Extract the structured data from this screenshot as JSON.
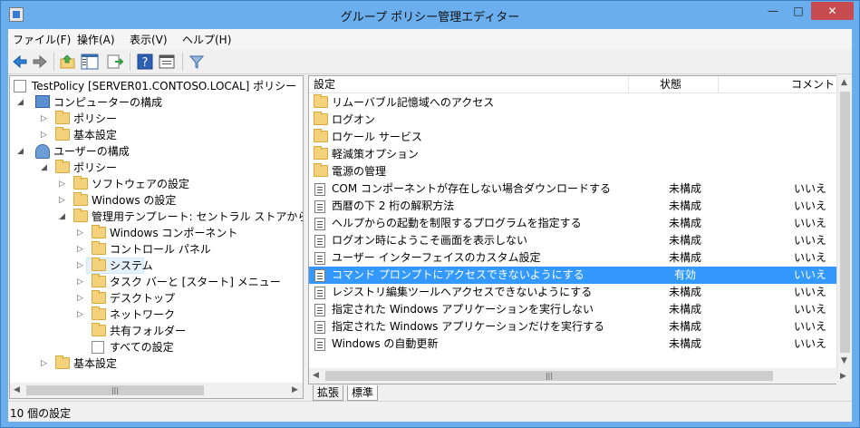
{
  "window": {
    "title": "グループ ポリシー管理エディター",
    "min_label": "—",
    "max_label": "□",
    "close_label": "✕"
  },
  "menu": {
    "file": "ファイル(F)",
    "action": "操作(A)",
    "view": "表示(V)",
    "help": "ヘルプ(H)"
  },
  "tree": {
    "root": "TestPolicy [SERVER01.CONTOSO.LOCAL] ポリシー",
    "computer_config": "コンピューターの構成",
    "computer_policy": "ポリシー",
    "computer_prefs": "基本設定",
    "user_config": "ユーザーの構成",
    "user_policy": "ポリシー",
    "software_settings": "ソフトウェアの設定",
    "windows_settings": "Windows の設定",
    "admin_templates": "管理用テンプレート: セントラル ストアから取得したポ",
    "windows_components": "Windows コンポーネント",
    "control_panel": "コントロール パネル",
    "system": "システム",
    "taskbar_start": "タスク バーと [スタート] メニュー",
    "desktop": "デスクトップ",
    "network": "ネットワーク",
    "shared_folders": "共有フォルダー",
    "all_settings": "すべての設定",
    "user_prefs": "基本設定"
  },
  "list": {
    "headers": {
      "setting": "設定",
      "state": "状態",
      "comment": "コメント"
    },
    "folders": [
      "リムーバブル記憶域へのアクセス",
      "ログオン",
      "ロケール サービス",
      "軽減策オプション",
      "電源の管理"
    ],
    "settings": [
      {
        "name": "COM コンポーネントが存在しない場合ダウンロードする",
        "state": "未構成",
        "comment": "いいえ"
      },
      {
        "name": "西暦の下 2 桁の解釈方法",
        "state": "未構成",
        "comment": "いいえ"
      },
      {
        "name": "ヘルプからの起動を制限するプログラムを指定する",
        "state": "未構成",
        "comment": "いいえ"
      },
      {
        "name": "ログオン時にようこそ画面を表示しない",
        "state": "未構成",
        "comment": "いいえ"
      },
      {
        "name": "ユーザー インターフェイスのカスタム設定",
        "state": "未構成",
        "comment": "いいえ"
      },
      {
        "name": "コマンド プロンプトにアクセスできないようにする",
        "state": "有効",
        "comment": "いいえ"
      },
      {
        "name": "レジストリ編集ツールへアクセスできないようにする",
        "state": "未構成",
        "comment": "いいえ"
      },
      {
        "name": "指定された Windows アプリケーションを実行しない",
        "state": "未構成",
        "comment": "いいえ"
      },
      {
        "name": "指定された Windows アプリケーションだけを実行する",
        "state": "未構成",
        "comment": "いいえ"
      },
      {
        "name": "Windows の自動更新",
        "state": "未構成",
        "comment": "いいえ"
      }
    ]
  },
  "tabs": {
    "extended": "拡張",
    "standard": "標準"
  },
  "scroll": {
    "grip": "|||"
  },
  "status": {
    "text": "10 個の設定"
  },
  "colors": {
    "title_bar": "#6aaeed",
    "selection": "#3399ff",
    "close_button": "#c74b50"
  }
}
